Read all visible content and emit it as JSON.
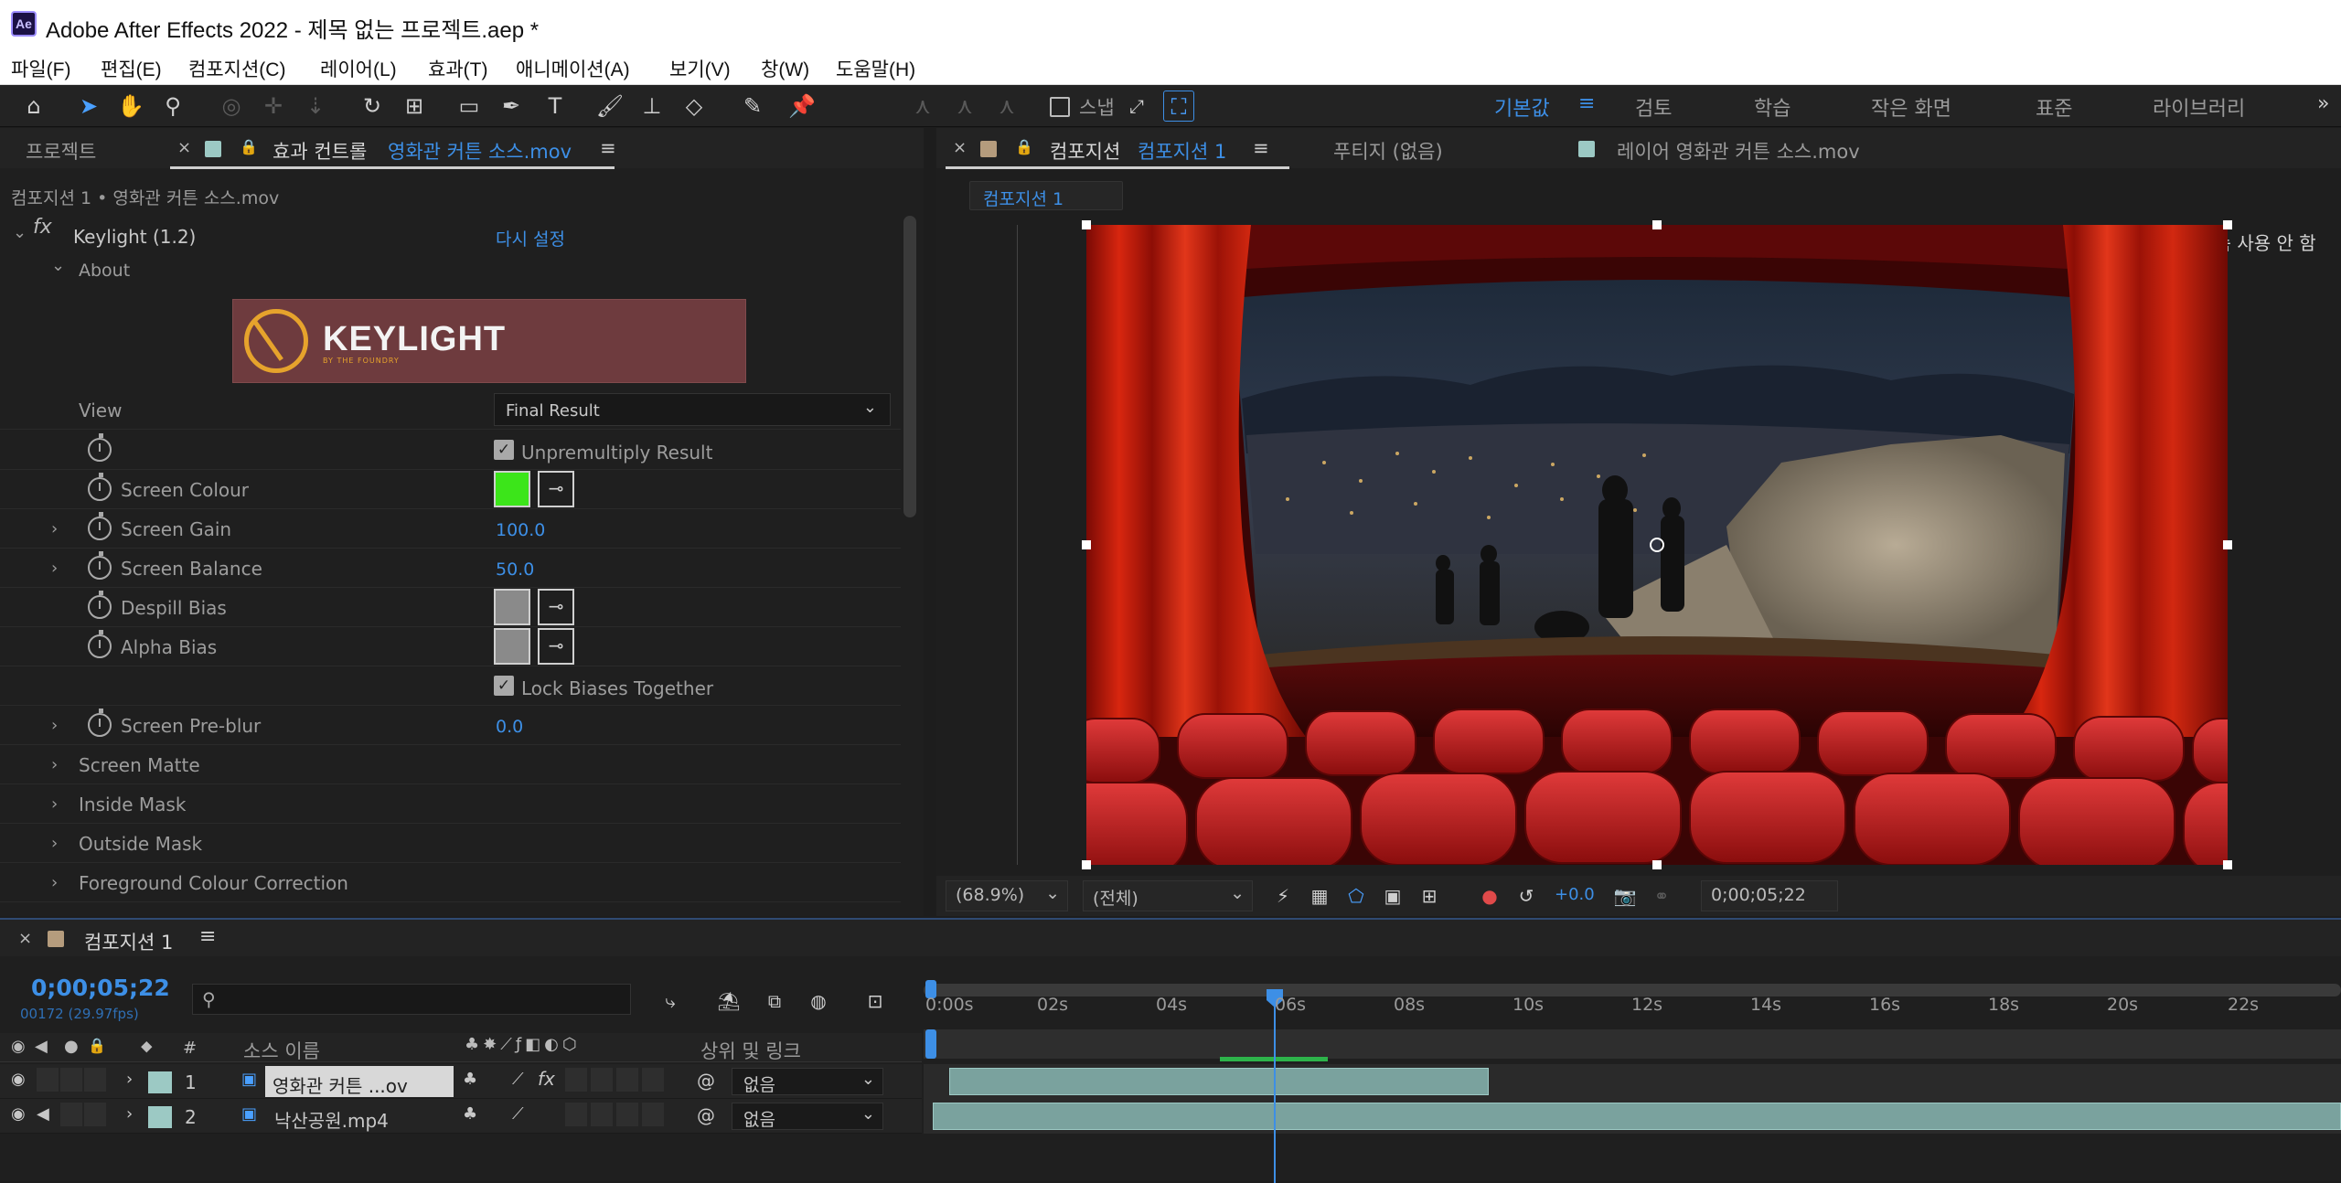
{
  "app": {
    "title": "Adobe After Effects 2022 - 제목 없는 프로젝트.aep *",
    "logo": "Ae"
  },
  "menu": [
    "파일(F)",
    "편집(E)",
    "컴포지션(C)",
    "레이어(L)",
    "효과(T)",
    "애니메이션(A)",
    "보기(V)",
    "창(W)",
    "도움말(H)"
  ],
  "toolbar": {
    "snap_label": "스냅",
    "workspaces": [
      "기본값",
      "검토",
      "학습",
      "작은 화면",
      "표준",
      "라이브러리"
    ],
    "active_workspace": "기본값",
    "more_icon": "»"
  },
  "left_panel": {
    "tab_project": "프로젝트",
    "tab_effects_prefix": "효과 컨트롤",
    "tab_effects_layer": "영화관 커튼 소스.mov",
    "breadcrumb": "컴포지션 1 • 영화관 커튼 소스.mov",
    "effect": {
      "fx": "fx",
      "name": "Keylight (1.2)",
      "reset": "다시 설정",
      "about": "About",
      "logo_text": "KEYLIGHT",
      "logo_sub": "BY THE FOUNDRY",
      "rows": [
        {
          "label": "View",
          "value": "Final Result",
          "type": "dropdown"
        },
        {
          "label": "",
          "value": "Unpremultiply Result",
          "type": "checkbox"
        },
        {
          "label": "Screen Colour",
          "type": "color",
          "color": "#3ce51a"
        },
        {
          "label": "Screen Gain",
          "value": "100.0",
          "type": "number"
        },
        {
          "label": "Screen Balance",
          "value": "50.0",
          "type": "number"
        },
        {
          "label": "Despill Bias",
          "type": "color",
          "color": "#8a8a8a"
        },
        {
          "label": "Alpha Bias",
          "type": "color",
          "color": "#8a8a8a"
        },
        {
          "label": "",
          "value": "Lock Biases Together",
          "type": "checkbox"
        },
        {
          "label": "Screen Pre-blur",
          "value": "0.0",
          "type": "number"
        },
        {
          "label": "Screen Matte",
          "type": "group"
        },
        {
          "label": "Inside Mask",
          "type": "group"
        },
        {
          "label": "Outside Mask",
          "type": "group"
        },
        {
          "label": "Foreground Colour Correction",
          "type": "group"
        }
      ]
    }
  },
  "viewer_panel": {
    "tab_comp_prefix": "컴포지션",
    "tab_comp_name": "컴포지션 1",
    "tab_footage": "푸티지 (없음)",
    "tab_layer": "레이어 영화관 커튼 소스.mov",
    "breadcrumb_comp": "컴포지션 1",
    "accel_notice": "표시 가속 사용 안 함",
    "zoom": "(68.9%)",
    "resolution": "(전체)",
    "exposure": "+0.0",
    "timecode": "0;00;05;22"
  },
  "timeline": {
    "comp_tab": "컴포지션 1",
    "current_time": "0;00;05;22",
    "frame_info": "00172 (29.97fps)",
    "search_placeholder": "",
    "col_source": "소스 이름",
    "col_parent": "상위 및 링크",
    "col_num": "#",
    "ruler_labels": [
      "0:00s",
      "02s",
      "04s",
      "06s",
      "08s",
      "10s",
      "12s",
      "14s",
      "16s",
      "18s",
      "20s",
      "22s"
    ],
    "layers": [
      {
        "num": "1",
        "name": "영화관 커튼 ...ov",
        "parent": "없음",
        "color": "#9cc9c4",
        "fx": "fx"
      },
      {
        "num": "2",
        "name": "낙산공원.mp4",
        "parent": "없음",
        "color": "#9cc9c4",
        "fx": ""
      }
    ]
  }
}
